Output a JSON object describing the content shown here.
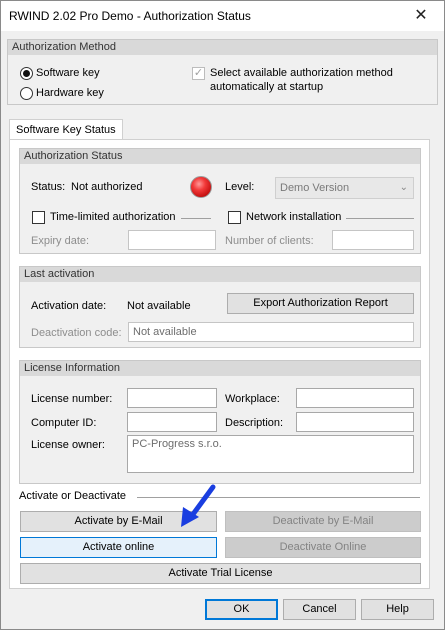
{
  "window": {
    "title": "RWIND 2.02 Pro Demo - Authorization Status",
    "close_glyph": "✕"
  },
  "auth_method": {
    "header": "Authorization Method",
    "software_key": "Software key",
    "hardware_key": "Hardware key",
    "auto_select": "Select available authorization method automatically at startup",
    "auto_select_line1": "Select available authorization method",
    "auto_select_line2": "automatically at startup",
    "check_glyph": "✓"
  },
  "tab": {
    "label": "Software Key Status"
  },
  "auth_status": {
    "header": "Authorization Status",
    "status_label": "Status:",
    "status_value": "Not authorized",
    "level_label": "Level:",
    "level_value": "Demo Version",
    "time_limited": "Time-limited authorization",
    "network": "Network installation",
    "expiry_label": "Expiry date:",
    "clients_label": "Number of clients:",
    "led_color": "#e32121"
  },
  "last_activation": {
    "header": "Last activation",
    "activation_date_label": "Activation date:",
    "activation_date_value": "Not available",
    "export_button": "Export Authorization Report",
    "deactivation_code_label": "Deactivation code:",
    "deactivation_code_value": "Not available"
  },
  "license": {
    "header": "License Information",
    "license_number_label": "License number:",
    "workplace_label": "Workplace:",
    "computer_id_label": "Computer ID:",
    "description_label": "Description:",
    "owner_label": "License owner:",
    "owner_value": "PC-Progress s.r.o."
  },
  "activate": {
    "header": "Activate or Deactivate",
    "by_email": "Activate by E-Mail",
    "deactivate_email": "Deactivate by E-Mail",
    "online": "Activate online",
    "deactivate_online": "Deactivate Online",
    "trial": "Activate Trial License"
  },
  "footer": {
    "ok": "OK",
    "cancel": "Cancel",
    "help": "Help"
  },
  "colors": {
    "accent": "#0078d7",
    "pointer_arrow": "#1a3ee0"
  }
}
